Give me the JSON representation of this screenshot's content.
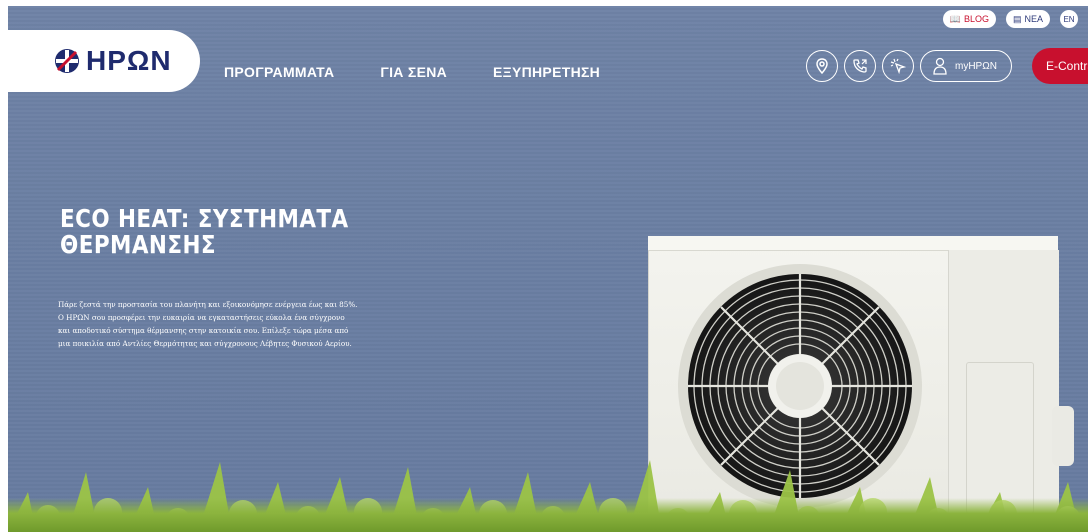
{
  "header": {
    "logo_text": "HPΩN",
    "nav": [
      "ΠΡΟΓΡΑΜΜΑΤΑ",
      "ΓΙΑ ΣΕΝΑ",
      "ΕΞΥΠΗΡΕΤΗΣΗ"
    ],
    "top_links": {
      "blog": "BLOG",
      "nea": "NEA",
      "lang": "EN"
    },
    "icons": [
      "location-icon",
      "phone-icon",
      "cursor-icon"
    ],
    "account_label": "myHPΩN",
    "contract_label": "E-Contract"
  },
  "hero": {
    "title_line1": "ECO HEAT: ΣΥΣΤΗΜΑΤΑ",
    "title_line2": "ΘΕΡΜΑΝΣΗΣ",
    "description_lines": [
      "Πάρε ζεστά την προστασία του πλανήτη και εξοικονόμησε ενέργεια έως και 85%.",
      "Ο ΗΡΩΝ σου προσφέρει την ευκαιρία να εγκαταστήσεις εύκολα ένα σύγχρονο",
      "και αποδοτικό σύστημα θέρμανσης στην κατοικία σου. Επίλεξε τώρα μέσα από",
      "μια ποικιλία από Αντλίες Θερμότητας και σύγχρονους Λέβητες Φυσικού Αερίου."
    ]
  },
  "colors": {
    "brand_navy": "#1f2b6e",
    "brand_red": "#c8102e",
    "wall": "#6b7fa3"
  }
}
